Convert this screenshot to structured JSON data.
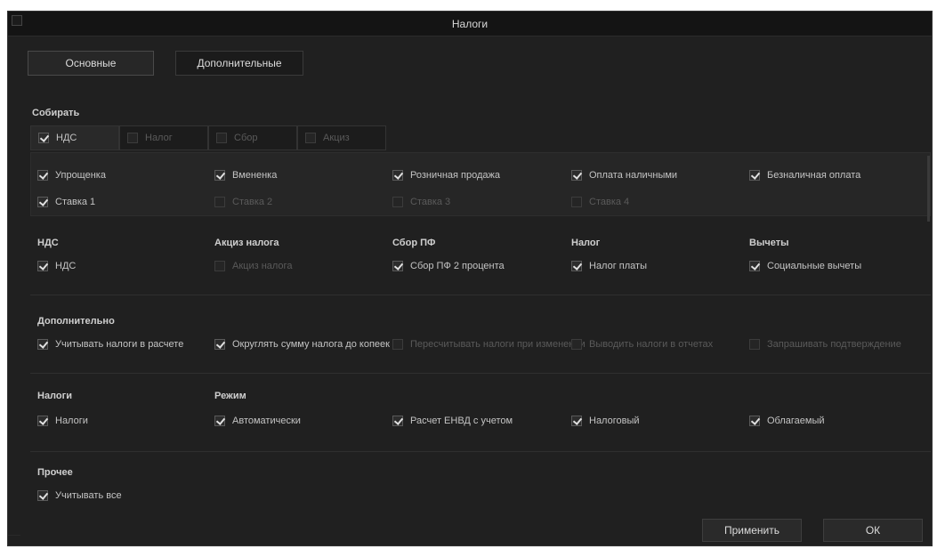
{
  "window": {
    "title": "Налоги"
  },
  "tabs": [
    {
      "label": "Основные"
    },
    {
      "label": "Дополнительные"
    }
  ],
  "groups": {
    "collect": {
      "title": "Собирать",
      "subtabs": [
        {
          "label": "НДС",
          "checked": true
        },
        {
          "label": "Налог",
          "checked": false
        },
        {
          "label": "Сбор",
          "checked": false
        },
        {
          "label": "Акциз",
          "checked": false
        }
      ],
      "row1": [
        {
          "label": "Упрощенка",
          "checked": true,
          "enabled": true
        },
        {
          "label": "Вмененка",
          "checked": true,
          "enabled": true
        },
        {
          "label": "Розничная продажа",
          "checked": true,
          "enabled": true
        },
        {
          "label": "Оплата наличными",
          "checked": true,
          "enabled": true
        },
        {
          "label": "Безналичная оплата",
          "checked": true,
          "enabled": true
        }
      ],
      "row2": [
        {
          "label": "Ставка 1",
          "checked": true,
          "enabled": true
        },
        {
          "label": "Ставка 2",
          "checked": false,
          "enabled": true
        },
        {
          "label": "Ставка 3",
          "checked": false,
          "enabled": false
        },
        {
          "label": "Ставка 4",
          "checked": false,
          "enabled": false
        }
      ]
    },
    "row3_titles": [
      "НДС",
      "Акциз налога",
      "Сбор ПФ",
      "Налог",
      "Вычеты"
    ],
    "row3": [
      {
        "label": "НДС",
        "checked": true,
        "enabled": true
      },
      {
        "label": "Акциз налога",
        "checked": false,
        "enabled": false
      },
      {
        "label": "Сбор ПФ 2 процента",
        "checked": true,
        "enabled": true
      },
      {
        "label": "Налог платы",
        "checked": true,
        "enabled": true
      },
      {
        "label": "Социальные вычеты",
        "checked": true,
        "enabled": true
      }
    ],
    "additional": {
      "title": "Дополнительно",
      "items": [
        {
          "label": "Учитывать налоги в расчете",
          "checked": true,
          "enabled": true
        },
        {
          "label": "Округлять сумму налога до копеек",
          "checked": true,
          "enabled": true
        },
        {
          "label": "Пересчитывать налоги при изменении",
          "checked": false,
          "enabled": false
        },
        {
          "label": "Выводить налоги в отчетах",
          "checked": false,
          "enabled": false
        },
        {
          "label": "Запрашивать подтверждение",
          "checked": false,
          "enabled": false
        }
      ]
    },
    "row5_titles": [
      "Налоги",
      "Режим"
    ],
    "row5": [
      {
        "label": "Налоги",
        "checked": true,
        "enabled": true
      },
      {
        "label": "Автоматически",
        "checked": true,
        "enabled": true
      },
      {
        "label": "Расчет ЕНВД с учетом",
        "checked": true,
        "enabled": true
      },
      {
        "label": "Налоговый",
        "checked": true,
        "enabled": true
      },
      {
        "label": "Облагаемый",
        "checked": true,
        "enabled": true
      }
    ],
    "other": {
      "title": "Прочее",
      "items": [
        {
          "label": "Учитывать все",
          "checked": true,
          "enabled": true
        }
      ]
    }
  },
  "footer": {
    "apply_label": "Применить",
    "ok_label": "ОК"
  }
}
